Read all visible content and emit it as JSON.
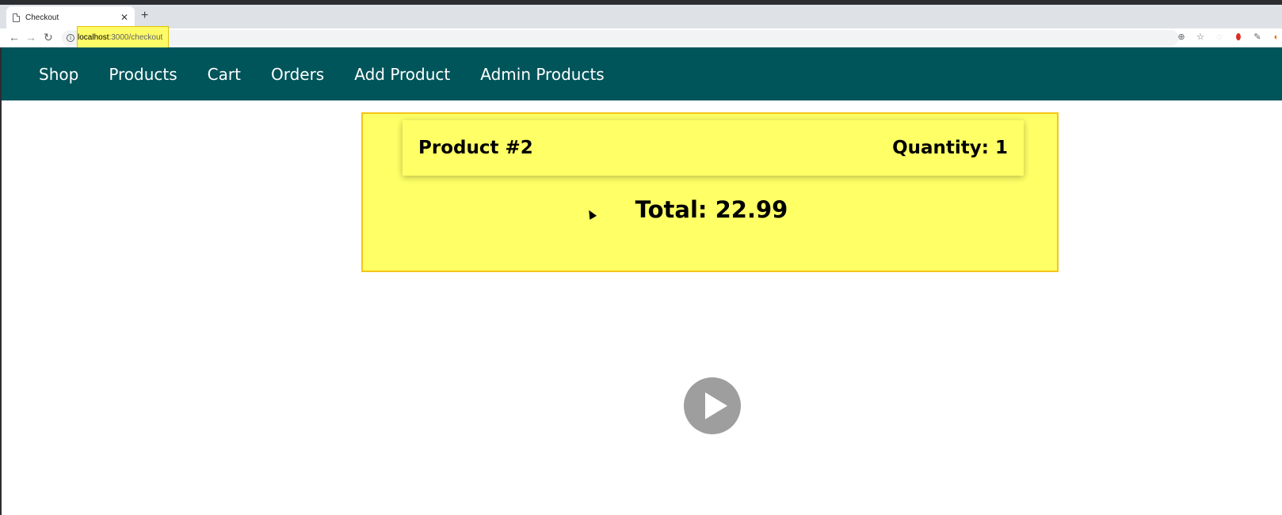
{
  "browser": {
    "tab_title": "Checkout",
    "url_host": "localhost",
    "url_path": ":3000/checkout",
    "icons": [
      "document-icon",
      "close-icon",
      "new-tab-icon",
      "back-icon",
      "forward-icon",
      "reload-icon",
      "info-icon",
      "zoom-icon",
      "star-icon",
      "extension-icon",
      "opera-icon",
      "eyedropper-icon",
      "chrome-extension-icon"
    ]
  },
  "nav": {
    "items": [
      "Shop",
      "Products",
      "Cart",
      "Orders",
      "Add Product",
      "Admin Products"
    ]
  },
  "checkout": {
    "item_title": "Product #2",
    "item_quantity": "Quantity: 1",
    "total": "Total: 22.99"
  },
  "colors": {
    "nav_bg": "#00555a",
    "card_bg": "#ffff66",
    "card_border": "#f5c518",
    "play_button": "#9e9e9e"
  }
}
